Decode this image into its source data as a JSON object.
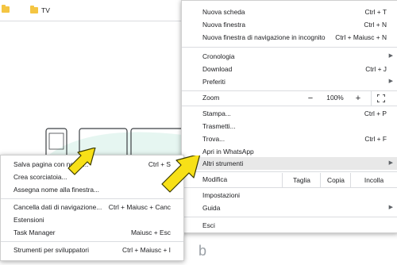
{
  "bookmarks_bar": {
    "items": [
      {
        "label": ""
      },
      {
        "label": "TV"
      }
    ]
  },
  "page_bottom_text": "b",
  "main_menu": {
    "new_tab": {
      "label": "Nuova scheda",
      "shortcut": "Ctrl + T"
    },
    "new_window": {
      "label": "Nuova finestra",
      "shortcut": "Ctrl + N"
    },
    "incognito": {
      "label": "Nuova finestra di navigazione in incognito",
      "shortcut": "Ctrl + Maiusc + N"
    },
    "history": {
      "label": "Cronologia"
    },
    "downloads": {
      "label": "Download",
      "shortcut": "Ctrl + J"
    },
    "bookmarks": {
      "label": "Preferiti"
    },
    "zoom": {
      "label": "Zoom",
      "minus": "−",
      "value": "100%",
      "plus": "+"
    },
    "print": {
      "label": "Stampa...",
      "shortcut": "Ctrl + P"
    },
    "cast": {
      "label": "Trasmetti..."
    },
    "find": {
      "label": "Trova...",
      "shortcut": "Ctrl + F"
    },
    "open_whatsapp": {
      "label": "Apri in WhatsApp"
    },
    "more_tools": {
      "label": "Altri strumenti"
    },
    "edit": {
      "label": "Modifica",
      "cut": "Taglia",
      "copy": "Copia",
      "paste": "Incolla"
    },
    "settings": {
      "label": "Impostazioni"
    },
    "help": {
      "label": "Guida"
    },
    "exit": {
      "label": "Esci"
    }
  },
  "sub_menu": {
    "save_page": {
      "label": "Salva pagina con nome...",
      "shortcut": "Ctrl + S"
    },
    "create_shortcut": {
      "label": "Crea scorciatoia..."
    },
    "name_window": {
      "label": "Assegna nome alla finestra..."
    },
    "clear_data": {
      "label": "Cancella dati di navigazione...",
      "shortcut": "Ctrl + Maiusc + Canc"
    },
    "extensions": {
      "label": "Estensioni"
    },
    "task_manager": {
      "label": "Task Manager",
      "shortcut": "Maiusc + Esc"
    },
    "dev_tools": {
      "label": "Strumenti per sviluppatori",
      "shortcut": "Ctrl + Maiusc + I"
    }
  },
  "colors": {
    "highlight": "#e8e8e8",
    "arrow_fill": "#f7e017",
    "folder": "#f4c542"
  }
}
